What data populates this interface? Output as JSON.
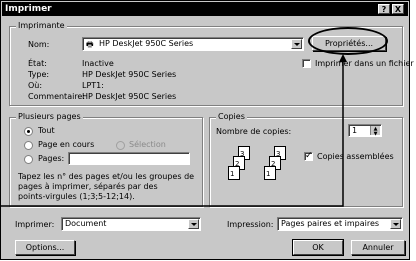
{
  "title": "Imprimer",
  "title_buttons": [
    "?",
    "X"
  ],
  "printer_group": {
    "legend": "Imprimante",
    "name_label": "Nom:",
    "name_value": "HP DeskJet 950C Series",
    "properties_button": "Propriétés...",
    "status_label": "État:",
    "status_value": "Inactive",
    "type_label": "Type:",
    "type_value": "HP DeskJet 950C Series",
    "where_label": "Où:",
    "where_value": "LPT1:",
    "comment_label": "Commentaire:",
    "comment_value": "HP DeskJet 950C Series",
    "print_to_file_label": "Imprimer dans un fichier",
    "print_to_file_checked": false
  },
  "pages_group": {
    "legend": "Plusieurs pages",
    "all_label": "Tout",
    "current_label": "Page en cours",
    "selection_label": "Sélection",
    "pages_label": "Pages:",
    "pages_value": "",
    "help_text_1": "Tapez les n° des pages et/ou les groupes de",
    "help_text_2": "pages à imprimer, séparés par des",
    "help_text_3": "points-virgules (1;3;5-12;14).",
    "selected": "all"
  },
  "copies_group": {
    "legend": "Copies",
    "count_label": "Nombre de copies:",
    "count_value": "1",
    "collate_label": "Copies assemblées",
    "collate_checked": true,
    "stack_left": [
      "3",
      "2",
      "1"
    ],
    "stack_right": [
      "3",
      "2",
      "1"
    ]
  },
  "footer": {
    "print_label": "Imprimer:",
    "print_value": "Document",
    "printing_label": "Impression:",
    "printing_value": "Pages paires et impaires",
    "options_button": "Options...",
    "ok_button": "OK",
    "cancel_button": "Annuler"
  }
}
